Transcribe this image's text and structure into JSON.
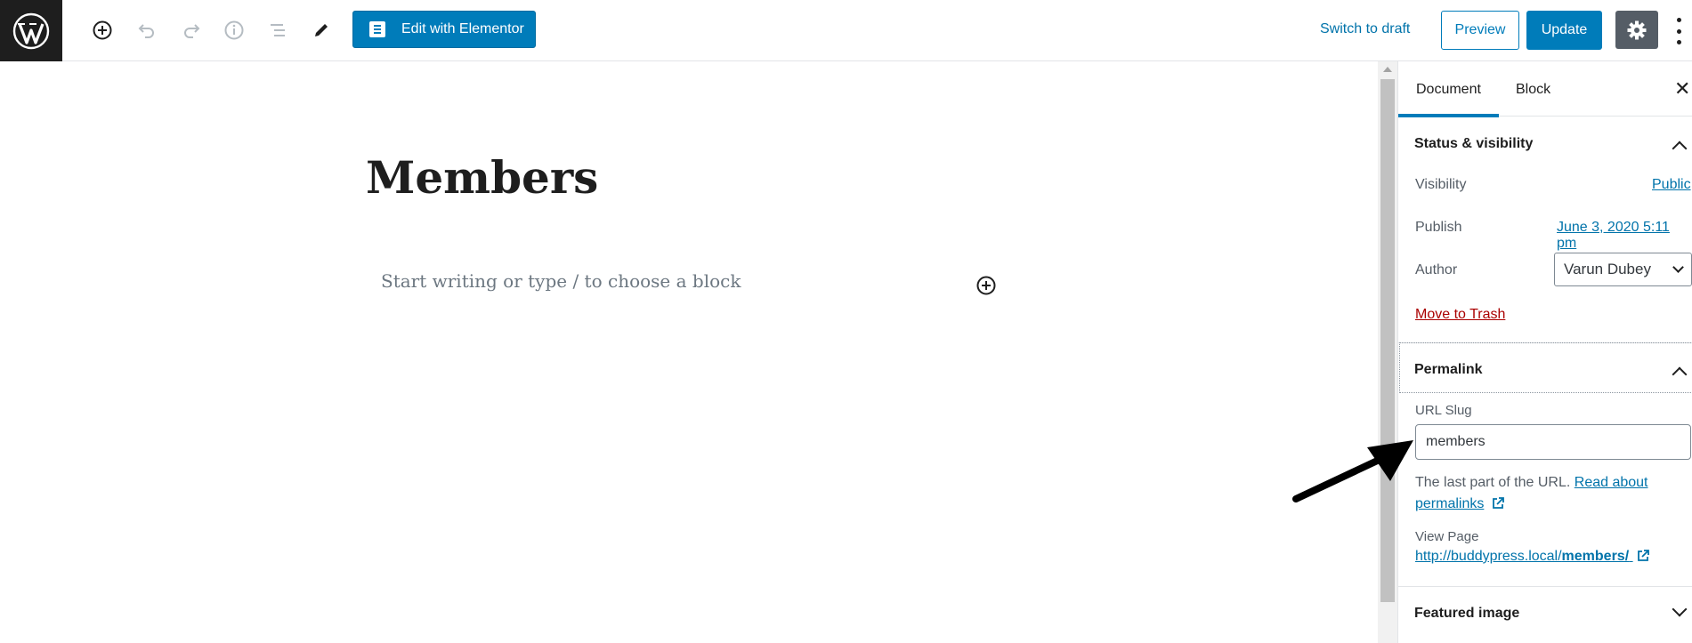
{
  "toolbar": {
    "elementor_label": "Edit with Elementor",
    "switch_draft_label": "Switch to draft",
    "preview_label": "Preview",
    "update_label": "Update",
    "icons": [
      "wordpress-logo",
      "add-block-icon",
      "undo-icon",
      "redo-icon",
      "info-icon",
      "list-view-icon",
      "edit-tools-icon",
      "gear-icon",
      "more-options-icon"
    ]
  },
  "editor": {
    "title": "Members",
    "placeholder": "Start writing or type / to choose a block"
  },
  "sidebar": {
    "tabs": [
      "Document",
      "Block"
    ],
    "active_tab": "Document",
    "status": {
      "heading": "Status & visibility",
      "visibility_label": "Visibility",
      "visibility_value": "Public",
      "publish_label": "Publish",
      "publish_value": "June 3, 2020 5:11 pm",
      "author_label": "Author",
      "author_value": "Varun Dubey",
      "trash_label": "Move to Trash"
    },
    "permalink": {
      "heading": "Permalink",
      "slug_label": "URL Slug",
      "slug_value": "members",
      "help_text": "The last part of the URL.",
      "help_link": "Read about permalinks",
      "view_label": "View Page",
      "view_url_prefix": "http://buddypress.local/",
      "view_url_slug": "members/"
    },
    "featured": {
      "heading": "Featured image"
    }
  },
  "colors": {
    "accent": "#007cba",
    "link": "#0073aa",
    "danger": "#a00",
    "dark": "#1e1e1e"
  }
}
